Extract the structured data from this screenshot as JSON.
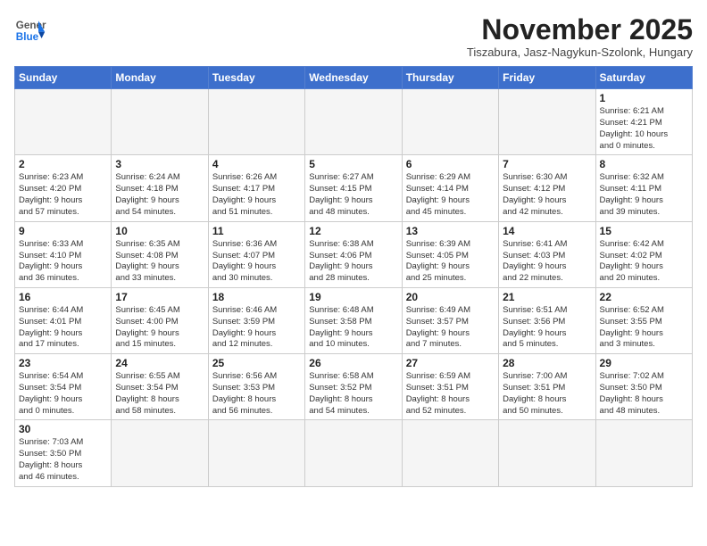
{
  "header": {
    "logo_general": "General",
    "logo_blue": "Blue",
    "month_title": "November 2025",
    "subtitle": "Tiszabura, Jasz-Nagykun-Szolonk, Hungary"
  },
  "weekdays": [
    "Sunday",
    "Monday",
    "Tuesday",
    "Wednesday",
    "Thursday",
    "Friday",
    "Saturday"
  ],
  "weeks": [
    [
      {
        "day": "",
        "info": ""
      },
      {
        "day": "",
        "info": ""
      },
      {
        "day": "",
        "info": ""
      },
      {
        "day": "",
        "info": ""
      },
      {
        "day": "",
        "info": ""
      },
      {
        "day": "",
        "info": ""
      },
      {
        "day": "1",
        "info": "Sunrise: 6:21 AM\nSunset: 4:21 PM\nDaylight: 10 hours\nand 0 minutes."
      }
    ],
    [
      {
        "day": "2",
        "info": "Sunrise: 6:23 AM\nSunset: 4:20 PM\nDaylight: 9 hours\nand 57 minutes."
      },
      {
        "day": "3",
        "info": "Sunrise: 6:24 AM\nSunset: 4:18 PM\nDaylight: 9 hours\nand 54 minutes."
      },
      {
        "day": "4",
        "info": "Sunrise: 6:26 AM\nSunset: 4:17 PM\nDaylight: 9 hours\nand 51 minutes."
      },
      {
        "day": "5",
        "info": "Sunrise: 6:27 AM\nSunset: 4:15 PM\nDaylight: 9 hours\nand 48 minutes."
      },
      {
        "day": "6",
        "info": "Sunrise: 6:29 AM\nSunset: 4:14 PM\nDaylight: 9 hours\nand 45 minutes."
      },
      {
        "day": "7",
        "info": "Sunrise: 6:30 AM\nSunset: 4:12 PM\nDaylight: 9 hours\nand 42 minutes."
      },
      {
        "day": "8",
        "info": "Sunrise: 6:32 AM\nSunset: 4:11 PM\nDaylight: 9 hours\nand 39 minutes."
      }
    ],
    [
      {
        "day": "9",
        "info": "Sunrise: 6:33 AM\nSunset: 4:10 PM\nDaylight: 9 hours\nand 36 minutes."
      },
      {
        "day": "10",
        "info": "Sunrise: 6:35 AM\nSunset: 4:08 PM\nDaylight: 9 hours\nand 33 minutes."
      },
      {
        "day": "11",
        "info": "Sunrise: 6:36 AM\nSunset: 4:07 PM\nDaylight: 9 hours\nand 30 minutes."
      },
      {
        "day": "12",
        "info": "Sunrise: 6:38 AM\nSunset: 4:06 PM\nDaylight: 9 hours\nand 28 minutes."
      },
      {
        "day": "13",
        "info": "Sunrise: 6:39 AM\nSunset: 4:05 PM\nDaylight: 9 hours\nand 25 minutes."
      },
      {
        "day": "14",
        "info": "Sunrise: 6:41 AM\nSunset: 4:03 PM\nDaylight: 9 hours\nand 22 minutes."
      },
      {
        "day": "15",
        "info": "Sunrise: 6:42 AM\nSunset: 4:02 PM\nDaylight: 9 hours\nand 20 minutes."
      }
    ],
    [
      {
        "day": "16",
        "info": "Sunrise: 6:44 AM\nSunset: 4:01 PM\nDaylight: 9 hours\nand 17 minutes."
      },
      {
        "day": "17",
        "info": "Sunrise: 6:45 AM\nSunset: 4:00 PM\nDaylight: 9 hours\nand 15 minutes."
      },
      {
        "day": "18",
        "info": "Sunrise: 6:46 AM\nSunset: 3:59 PM\nDaylight: 9 hours\nand 12 minutes."
      },
      {
        "day": "19",
        "info": "Sunrise: 6:48 AM\nSunset: 3:58 PM\nDaylight: 9 hours\nand 10 minutes."
      },
      {
        "day": "20",
        "info": "Sunrise: 6:49 AM\nSunset: 3:57 PM\nDaylight: 9 hours\nand 7 minutes."
      },
      {
        "day": "21",
        "info": "Sunrise: 6:51 AM\nSunset: 3:56 PM\nDaylight: 9 hours\nand 5 minutes."
      },
      {
        "day": "22",
        "info": "Sunrise: 6:52 AM\nSunset: 3:55 PM\nDaylight: 9 hours\nand 3 minutes."
      }
    ],
    [
      {
        "day": "23",
        "info": "Sunrise: 6:54 AM\nSunset: 3:54 PM\nDaylight: 9 hours\nand 0 minutes."
      },
      {
        "day": "24",
        "info": "Sunrise: 6:55 AM\nSunset: 3:54 PM\nDaylight: 8 hours\nand 58 minutes."
      },
      {
        "day": "25",
        "info": "Sunrise: 6:56 AM\nSunset: 3:53 PM\nDaylight: 8 hours\nand 56 minutes."
      },
      {
        "day": "26",
        "info": "Sunrise: 6:58 AM\nSunset: 3:52 PM\nDaylight: 8 hours\nand 54 minutes."
      },
      {
        "day": "27",
        "info": "Sunrise: 6:59 AM\nSunset: 3:51 PM\nDaylight: 8 hours\nand 52 minutes."
      },
      {
        "day": "28",
        "info": "Sunrise: 7:00 AM\nSunset: 3:51 PM\nDaylight: 8 hours\nand 50 minutes."
      },
      {
        "day": "29",
        "info": "Sunrise: 7:02 AM\nSunset: 3:50 PM\nDaylight: 8 hours\nand 48 minutes."
      }
    ],
    [
      {
        "day": "30",
        "info": "Sunrise: 7:03 AM\nSunset: 3:50 PM\nDaylight: 8 hours\nand 46 minutes."
      },
      {
        "day": "",
        "info": ""
      },
      {
        "day": "",
        "info": ""
      },
      {
        "day": "",
        "info": ""
      },
      {
        "day": "",
        "info": ""
      },
      {
        "day": "",
        "info": ""
      },
      {
        "day": "",
        "info": ""
      }
    ]
  ]
}
